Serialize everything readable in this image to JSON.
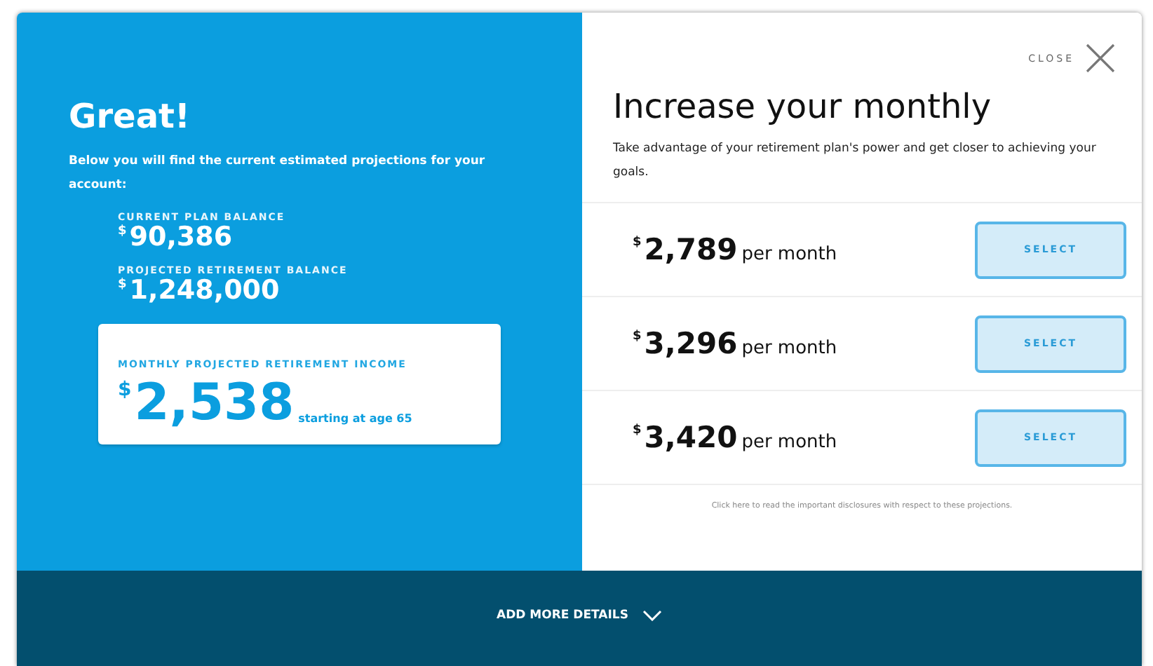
{
  "summary": {
    "title": "Great!",
    "description": "Below you will find the current estimated projections for your account:",
    "balances": [
      {
        "label": "CURRENT PLAN BALANCE",
        "currency": "$",
        "amount": "90,386"
      },
      {
        "label": "PROJECTED RETIREMENT BALANCE",
        "currency": "$",
        "amount": "1,248,000"
      }
    ],
    "income": {
      "label": "MONTHLY PROJECTED RETIREMENT INCOME",
      "currency": "$",
      "amount": "2,538",
      "note": "starting at age 65"
    }
  },
  "offer": {
    "close": "CLOSE",
    "title": "Increase your monthly",
    "description": "Take advantage of your retirement plan's power and get closer to achieving your goals.",
    "options": [
      {
        "currency": "$",
        "amount": "2,789",
        "unit": "per month",
        "button": "SELECT"
      },
      {
        "currency": "$",
        "amount": "3,296",
        "unit": "per month",
        "button": "SELECT"
      },
      {
        "currency": "$",
        "amount": "3,420",
        "unit": "per month",
        "button": "SELECT"
      }
    ],
    "disclosure": "Click here to read the important disclosures with respect to these projections."
  },
  "footer": {
    "label": "ADD MORE DETAILS"
  }
}
